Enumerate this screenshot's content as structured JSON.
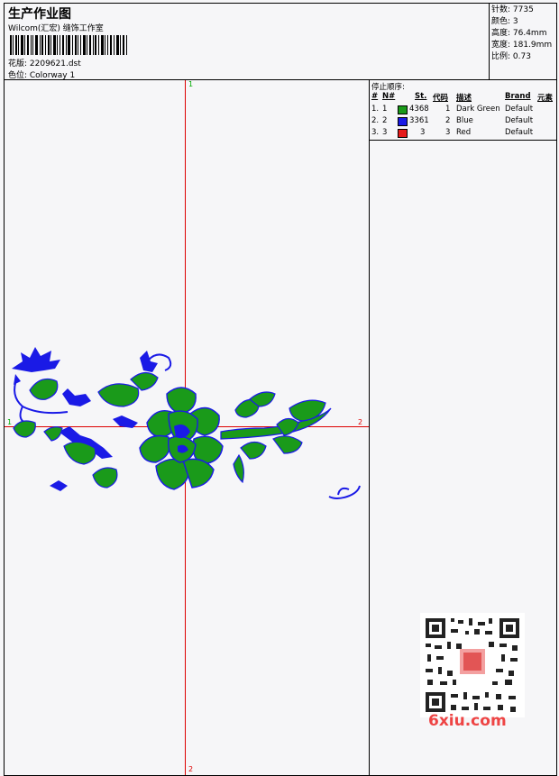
{
  "header": {
    "title": "生产作业图",
    "subtitle": "Wilcom(汇宏) 缝饰工作室",
    "file_label": "花版: 2209621.dst",
    "colorway_label": "色位: Colorway 1"
  },
  "stats": {
    "stitches": "针数: 7735",
    "colors": "颜色: 3",
    "height": "高度: 76.4mm",
    "width": "宽度: 181.9mm",
    "scale": "比例: 0.73"
  },
  "legend": {
    "title": "停止顺序:",
    "headers": {
      "num": "#",
      "n": "N#",
      "st": "St.",
      "code": "代码",
      "desc": "描述",
      "brand": "Brand",
      "elem": "元素"
    },
    "rows": [
      {
        "num": "1.",
        "n": "1",
        "stitches": "4368",
        "code": "1",
        "desc": "Dark Green",
        "brand": "Default",
        "color": "#1a9a1a"
      },
      {
        "num": "2.",
        "n": "2",
        "stitches": "3361",
        "code": "2",
        "desc": "Blue",
        "brand": "Default",
        "color": "#1a1ae6"
      },
      {
        "num": "3.",
        "n": "3",
        "stitches": "3",
        "code": "3",
        "desc": "Red",
        "brand": "Default",
        "color": "#e61a1a"
      }
    ]
  },
  "markers": {
    "v_top": "1",
    "v_bottom": "2",
    "h_left": "1",
    "h_right": "2"
  },
  "watermark": {
    "site": "6xiu.com"
  },
  "colors": {
    "dark_green": "#1a9a1a",
    "blue": "#1a1ae6",
    "red": "#e61a1a",
    "axis": "#dd0000"
  }
}
